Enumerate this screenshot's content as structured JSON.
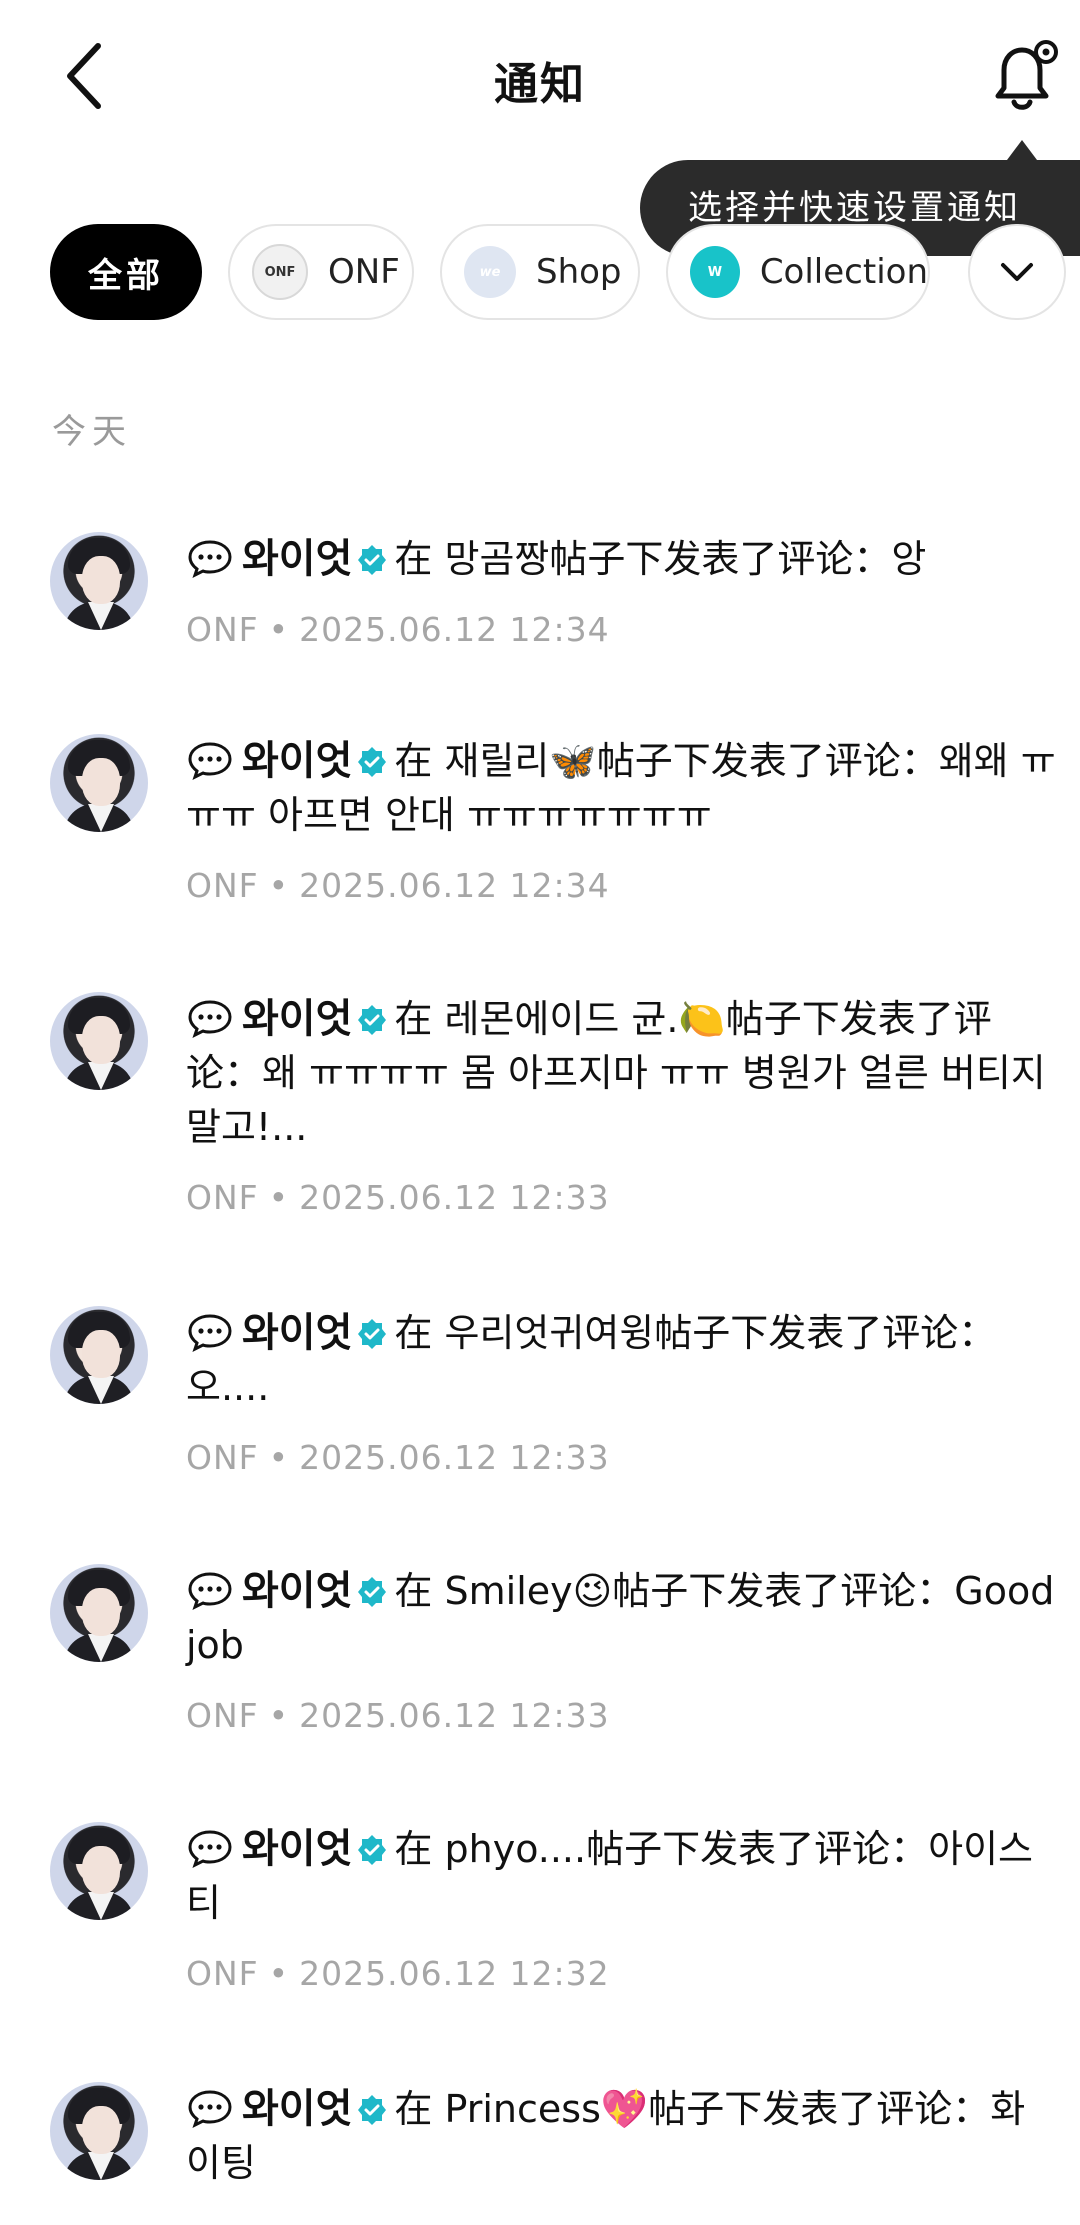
{
  "header": {
    "title": "通知"
  },
  "tooltip": {
    "text": "选择并快速设置通知"
  },
  "filters": [
    {
      "label": "全部",
      "icon": "",
      "active": true
    },
    {
      "label": "ONF",
      "icon": "onf-logo",
      "active": false
    },
    {
      "label": "Shop",
      "icon": "shop-logo",
      "active": false
    },
    {
      "label": "Collection",
      "icon": "collection-logo",
      "active": false
    }
  ],
  "icon_labels": {
    "onf": "ONF",
    "shop": "we",
    "collection": "W"
  },
  "section": {
    "today": "今天"
  },
  "notifications": [
    {
      "user": "와이엇",
      "prefix": "在 ",
      "target": "망곰짱",
      "suffix": "帖子下发表了评论：",
      "comment": "앙",
      "group": "ONF",
      "time": "2025.06.12 12:34"
    },
    {
      "user": "와이엇",
      "prefix": "在 ",
      "target": "재릴리🦋",
      "suffix": "帖子下发表了评论：",
      "comment": "왜왜 ㅠㅠㅠ 아프면 안대 ㅠㅠㅠㅠㅠㅠㅠ",
      "group": "ONF",
      "time": "2025.06.12 12:34"
    },
    {
      "user": "와이엇",
      "prefix": "在 ",
      "target": "레몬에이드 균.🍋",
      "suffix": "帖子下发表了评论：",
      "comment": "왜 ㅠㅠㅠㅠ 몸 아프지마 ㅠㅠ 병원가 얼른 버티지말고!...",
      "group": "ONF",
      "time": "2025.06.12 12:33"
    },
    {
      "user": "와이엇",
      "prefix": "在 ",
      "target": "우리엇귀여윙",
      "suffix": "帖子下发表了评论：",
      "comment": "오....",
      "group": "ONF",
      "time": "2025.06.12 12:33"
    },
    {
      "user": "와이엇",
      "prefix": "在 ",
      "target": "Smiley😉",
      "suffix": "帖子下发表了评论：",
      "comment": "Good job",
      "group": "ONF",
      "time": "2025.06.12 12:33"
    },
    {
      "user": "와이엇",
      "prefix": "在 ",
      "target": "phyo....",
      "suffix": "帖子下发表了评论：",
      "comment": "아이스티",
      "group": "ONF",
      "time": "2025.06.12 12:32"
    },
    {
      "user": "와이엇",
      "prefix": "在 ",
      "target": "Princess💖",
      "suffix": "帖子下发表了评论：",
      "comment": "화이팅",
      "group": "ONF",
      "time": ""
    }
  ]
}
